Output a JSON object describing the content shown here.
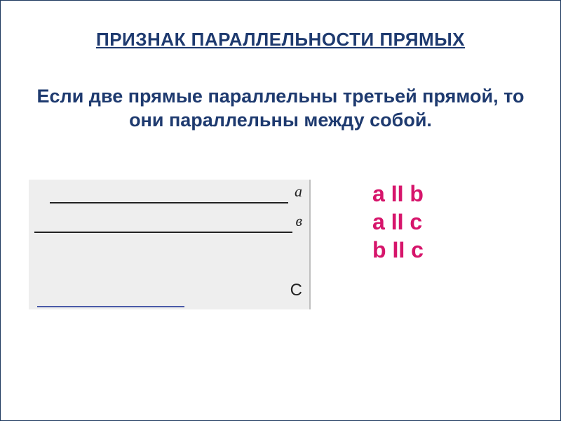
{
  "title": "ПРИЗНАК ПАРАЛЛЕЛЬНОСТИ ПРЯМЫХ",
  "body": "Если две прямые параллельны третьей прямой, то они параллельны между собой.",
  "diagram": {
    "labels": {
      "a": "a",
      "b": "в",
      "c": "С"
    }
  },
  "relations": {
    "r1": "a II b",
    "r2": "a II c",
    "r3": "b II c"
  }
}
